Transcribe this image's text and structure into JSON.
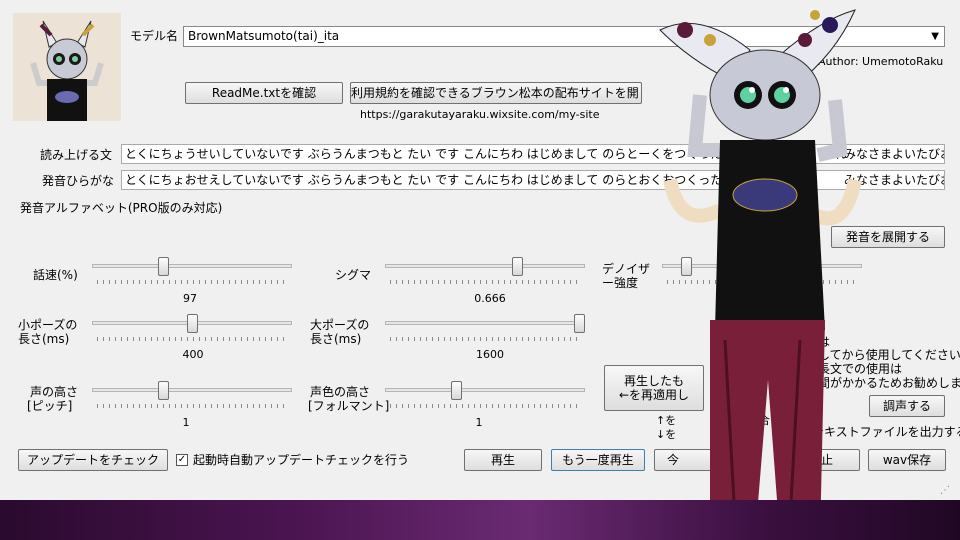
{
  "model": {
    "label": "モデル名",
    "selected": "BrownMatsumoto(tai)_ita",
    "author": "Author: UmemotoRaku"
  },
  "buttons": {
    "readme": "ReadMe.txtを確認",
    "terms": "利用規約を確認できるブラウン松本の配布サイトを開く",
    "expand": "発音を展開する",
    "tune": "調声する",
    "replay_apply": "再生したも",
    "replay_apply2": "←を再適用し",
    "update": "アップデートをチェック",
    "play": "再生",
    "play_again": "もう一度再生",
    "save": "今",
    "save2": "保",
    "stop": "停止",
    "wav": "wav保存"
  },
  "site_url": "https://garakutayaraku.wixsite.com/my-site",
  "text": {
    "read_label": "読み上げる文",
    "read_value": "とくにちょうせいしていないです ぶらうんまつもと たい です こんにちわ はじめまして のらとーくをつくったので よけ",
    "read_tail": "それ",
    "read_tail2": "みなさまよいたびお",
    "hira_label": "発音ひらがな",
    "hira_value": "とくにちょおせえしていないです ぶらうんまつもと たい です こんにちわ はじめまして のらとおくおつくったので よ",
    "hira_tail": "みなさまよいたびお",
    "alpha_label": "発音アルファベット(PRO版のみ対応)"
  },
  "sliders": [
    {
      "key": "speed",
      "label": "話速(%)",
      "value": "97",
      "level": 0.35
    },
    {
      "key": "sigma",
      "label": "シグマ",
      "value": "0.666",
      "level": 0.67
    },
    {
      "key": "denoise",
      "label": "デノイザー強度",
      "value": "",
      "level": 0.1
    },
    {
      "key": "small_pause",
      "label1": "小ポーズの",
      "label2": "長さ(ms)",
      "value": "400",
      "level": 0.5
    },
    {
      "key": "large_pause",
      "label1": "大ポーズの",
      "label2": "長さ(ms)",
      "value": "1600",
      "level": 1.0
    },
    {
      "key": "pitch",
      "label1": "声の高さ",
      "label2": "[ピッチ]",
      "value": "1",
      "level": 0.35
    },
    {
      "key": "formant",
      "label1": "声色の高さ",
      "label2": "[フォルマント]",
      "value": "1",
      "level": 0.35
    }
  ],
  "notes": {
    "l1": "は",
    "l2": "してから使用してください",
    "l3": "長文での使用は",
    "l4": "間がかかるためお勧めしません",
    "arrow_note1": "↑を",
    "arrow_note2": "↓を",
    "arrow_note3": "場合"
  },
  "checkboxes": {
    "auto_update": {
      "label": "起動時自動アップデートチェックを行う",
      "checked": true,
      "mark": "✓"
    },
    "text_file": {
      "label": "テキストファイルを出力する",
      "checked": false,
      "mark": ""
    }
  }
}
